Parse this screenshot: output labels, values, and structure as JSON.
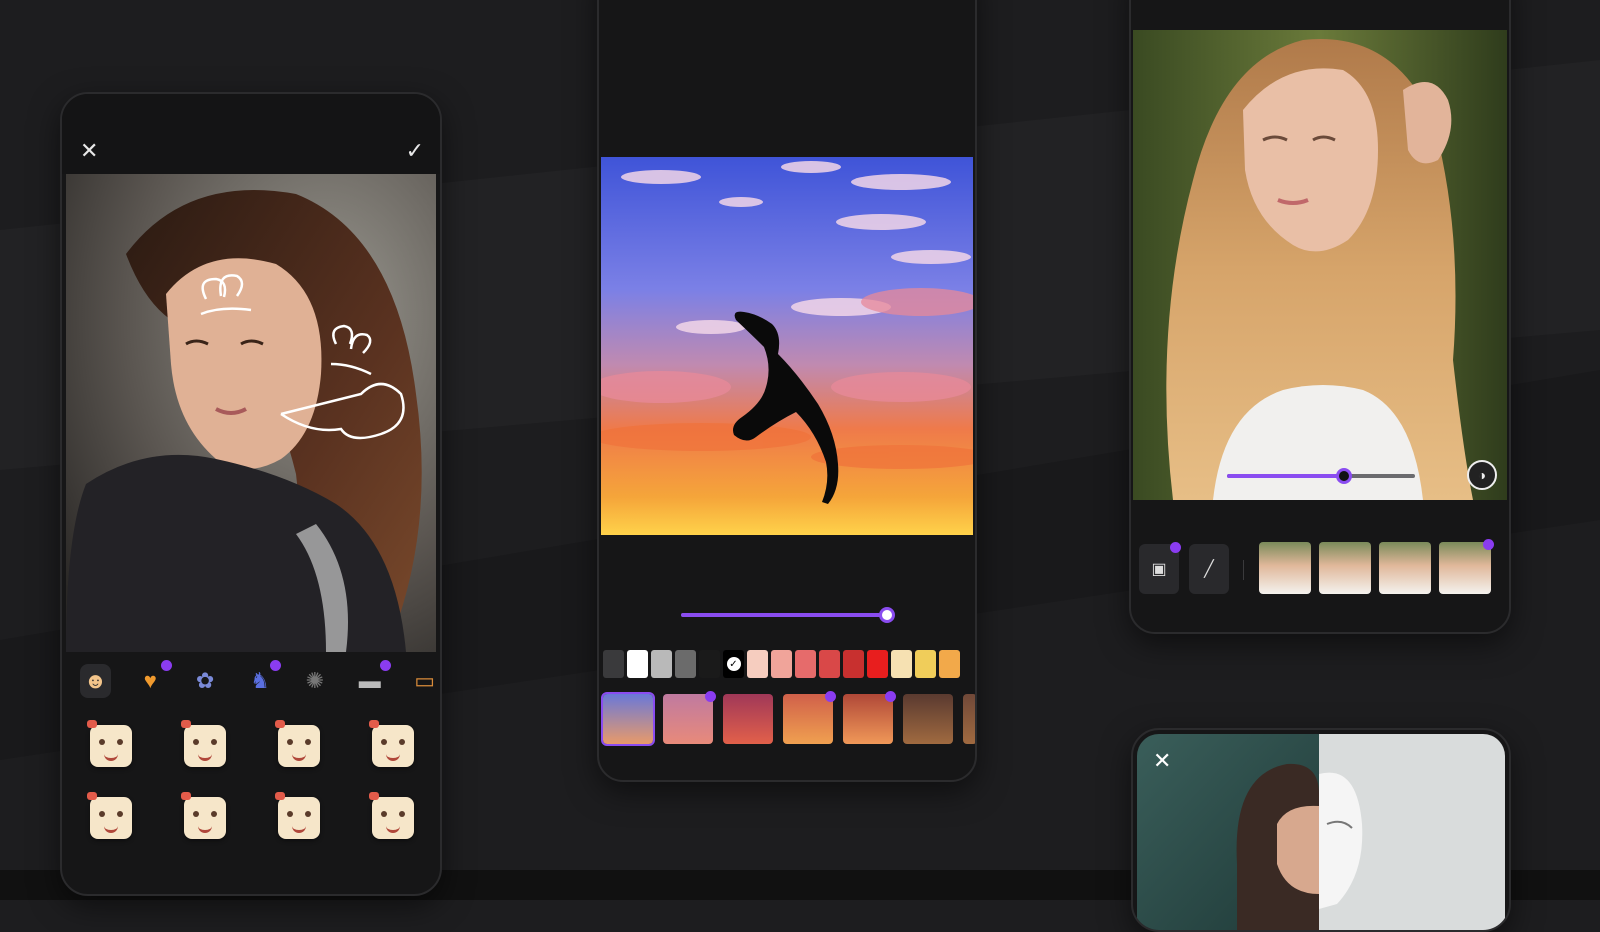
{
  "phone1": {
    "close_icon": "close-icon",
    "confirm_icon": "check-icon",
    "categories": [
      {
        "name": "emoji-face-icon",
        "glyph": "☻",
        "color": "#f2c48a",
        "premium": false,
        "active": true
      },
      {
        "name": "heart-icon",
        "glyph": "♥",
        "color": "#f09a2e",
        "premium": true,
        "active": false
      },
      {
        "name": "bow-icon",
        "glyph": "✿",
        "color": "#7a8ad8",
        "premium": false,
        "active": false
      },
      {
        "name": "cat-icon",
        "glyph": "♞",
        "color": "#5a6fe0",
        "premium": true,
        "active": false
      },
      {
        "name": "spark-icon",
        "glyph": "✺",
        "color": "#777",
        "premium": false,
        "active": false
      },
      {
        "name": "hat-icon",
        "glyph": "▬",
        "color": "#bbb",
        "premium": true,
        "active": false
      },
      {
        "name": "text-badge-icon",
        "glyph": "▭",
        "color": "#d98b3a",
        "premium": false,
        "active": false
      }
    ],
    "stickers_count": 8
  },
  "phone2": {
    "slider_value": 0.97,
    "swatches": [
      "#3a3a3c",
      "#ffffff",
      "#b9b9b9",
      "#6b6b6b",
      "#1a1a1a",
      "#000000",
      "#f6cdbf",
      "#f0a49a",
      "#e66b6b",
      "#d94848",
      "#c8302f",
      "#e81e1e",
      "#f6e1b2",
      "#f0cd5a",
      "#f2a94a"
    ],
    "thumbs": [
      {
        "label": "",
        "colors": [
          "#6a78d8",
          "#e89a6a"
        ],
        "selected": true,
        "premium": false
      },
      {
        "label": "",
        "colors": [
          "#c07aa0",
          "#e88a7a"
        ],
        "selected": false,
        "premium": true
      },
      {
        "label": "",
        "colors": [
          "#a03858",
          "#e2604a"
        ],
        "selected": false,
        "premium": false
      },
      {
        "label": "",
        "colors": [
          "#d0604a",
          "#f0a050"
        ],
        "selected": false,
        "premium": true
      },
      {
        "label": "",
        "colors": [
          "#b04838",
          "#f09858"
        ],
        "selected": false,
        "premium": true
      },
      {
        "label": "",
        "colors": [
          "#5a3a30",
          "#a06a40"
        ],
        "selected": false,
        "premium": false
      },
      {
        "label": "",
        "colors": [
          "#704838",
          "#a06a40"
        ],
        "selected": false,
        "premium": false
      }
    ]
  },
  "phone3": {
    "slider_value": 0.62,
    "tabs": [
      "",
      "",
      "",
      "",
      "",
      ""
    ],
    "tools": [
      "image-icon",
      "brush-icon"
    ],
    "filters": [
      {
        "label": ""
      },
      {
        "label": ""
      },
      {
        "label": ""
      },
      {
        "label": ""
      }
    ]
  },
  "phone4": {
    "close_icon": "close-icon"
  },
  "colors": {
    "accent": "#8a4cf0",
    "background": "#1d1d1f"
  }
}
